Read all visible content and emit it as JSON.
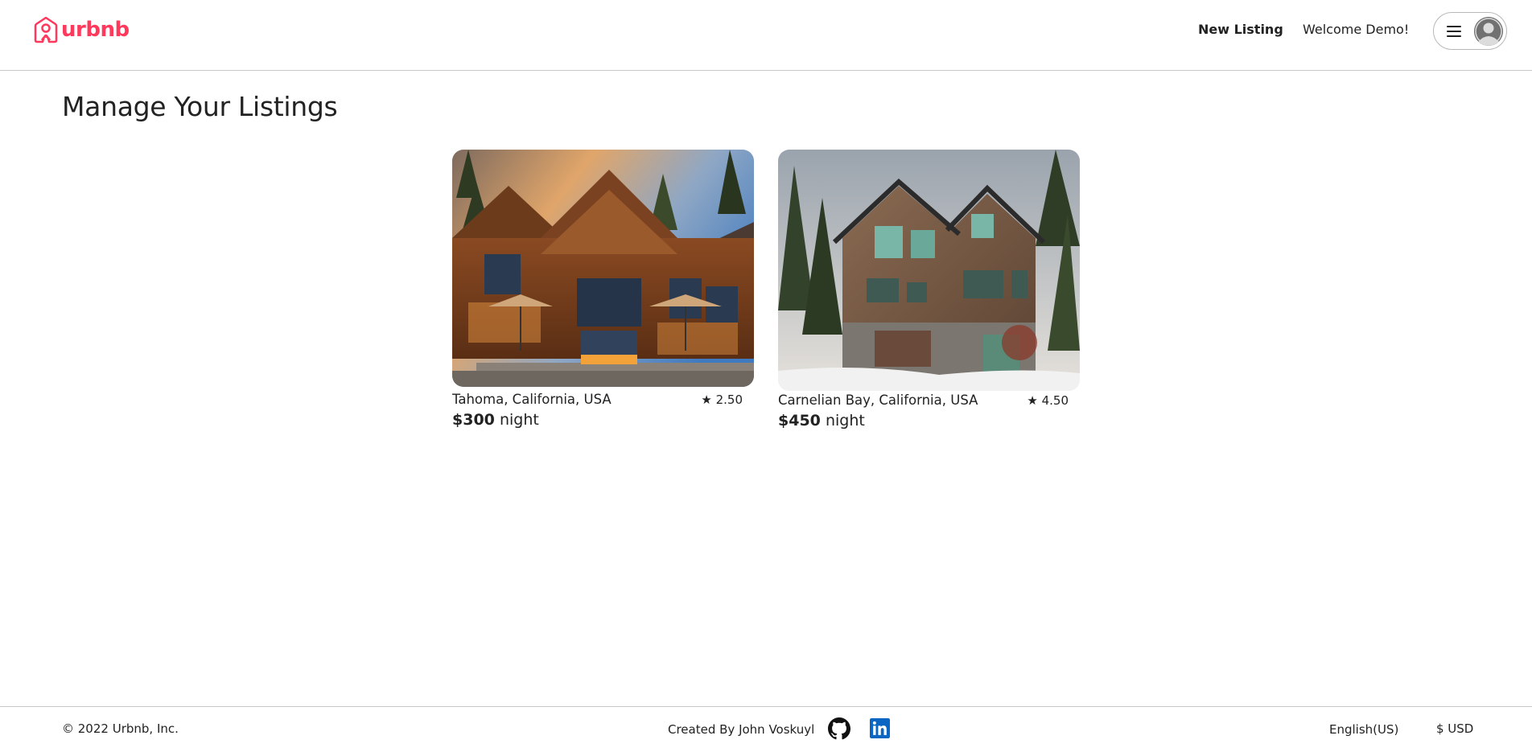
{
  "header": {
    "logo_text": "urbnb",
    "new_listing_label": "New Listing",
    "welcome_text": "Welcome Demo!",
    "menu_icon": "hamburger-icon",
    "avatar_icon": "default-avatar-icon"
  },
  "main": {
    "title": "Manage Your Listings",
    "listings": [
      {
        "location": "Tahoma, California, USA",
        "rating": "2.50",
        "price": "$300",
        "price_unit": "night"
      },
      {
        "location": "Carnelian Bay, California, USA",
        "rating": "4.50",
        "price": "$450",
        "price_unit": "night"
      }
    ],
    "rating_star": "★"
  },
  "footer": {
    "copyright": "© 2022 Urbnb, Inc.",
    "created_by": "Created By John Voskuyl",
    "language": "English(US)",
    "currency": "$ USD",
    "github_icon": "github-icon",
    "linkedin_icon": "linkedin-icon"
  },
  "colors": {
    "brand": "#ff385c",
    "linkedin": "#0a66c2",
    "text": "#222222"
  }
}
